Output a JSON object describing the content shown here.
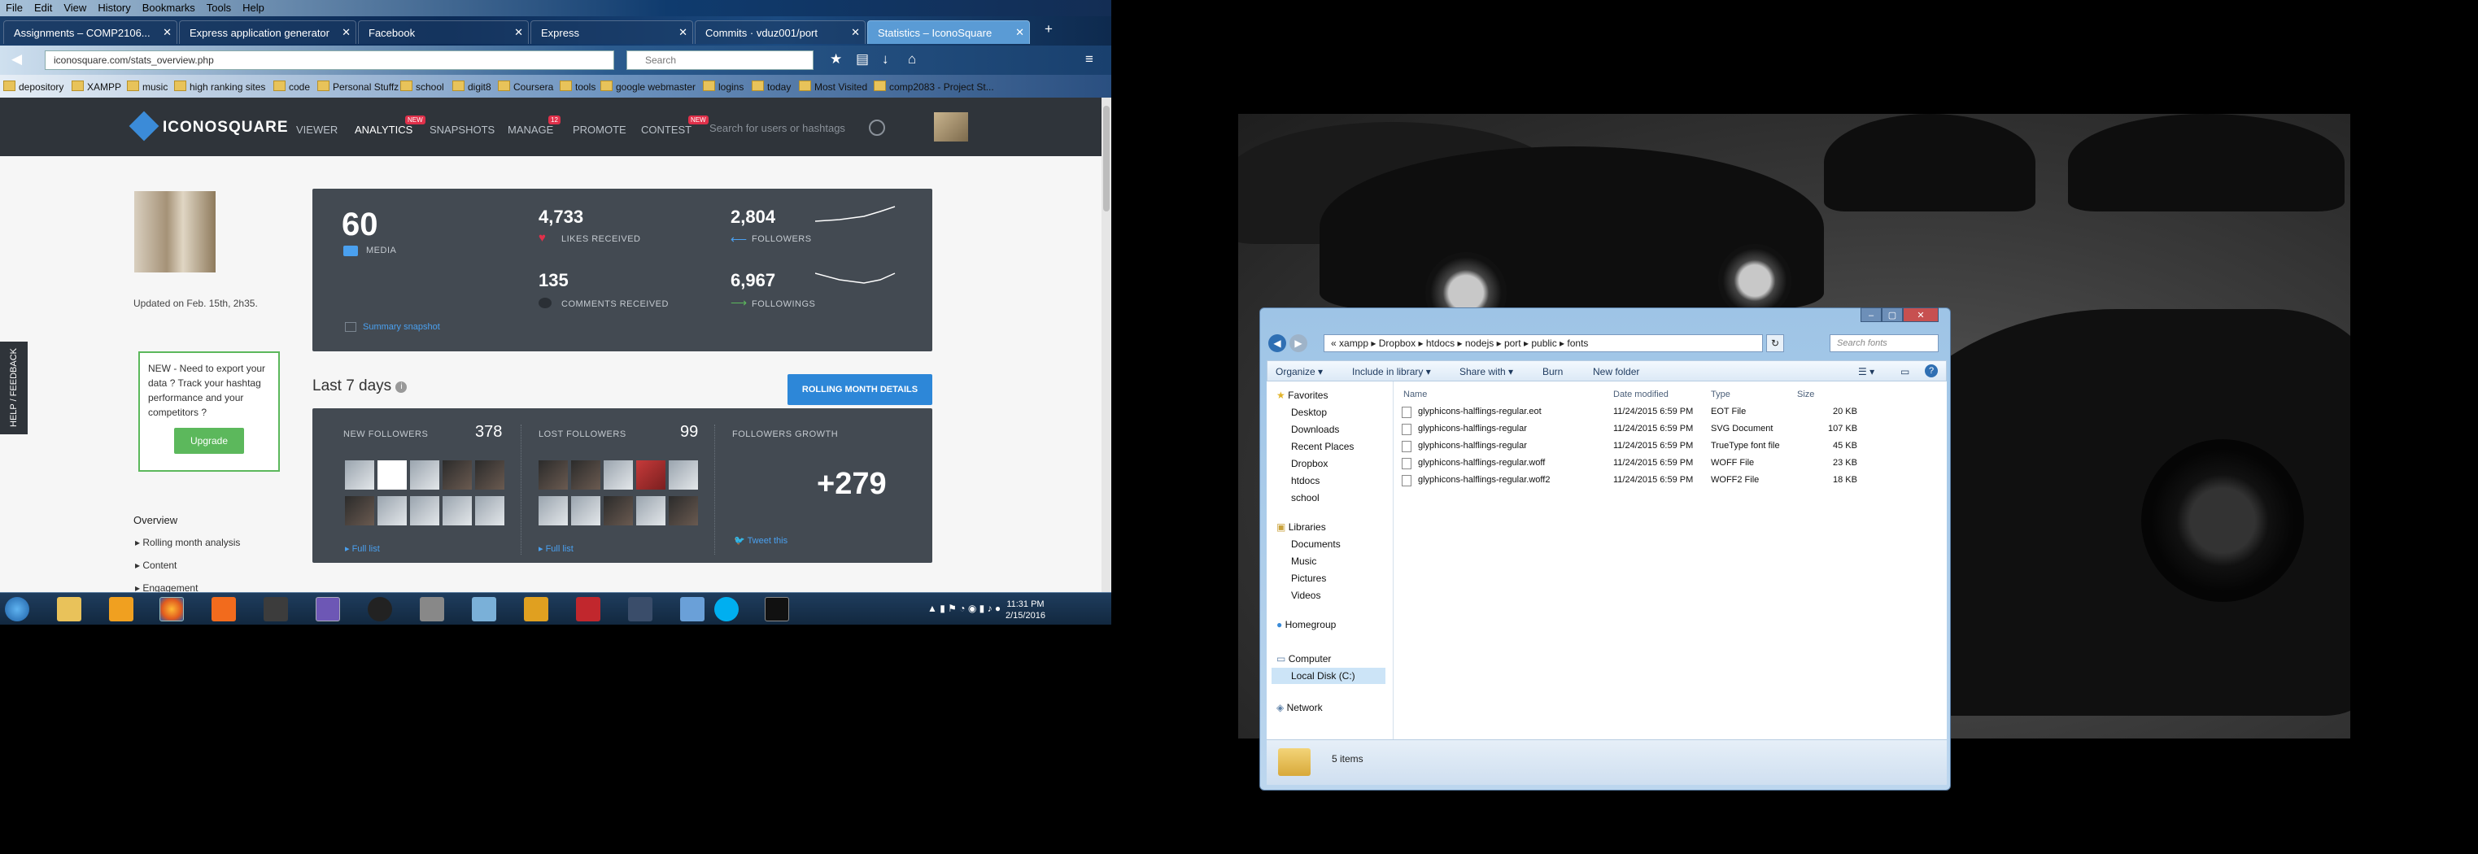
{
  "browser": {
    "menu": [
      "File",
      "Edit",
      "View",
      "History",
      "Bookmarks",
      "Tools",
      "Help"
    ],
    "tabs": [
      {
        "label": "Assignments – COMP2106..."
      },
      {
        "label": "Express application generator"
      },
      {
        "label": "Facebook"
      },
      {
        "label": "Express"
      },
      {
        "label": "Commits · vduz001/port"
      },
      {
        "label": "Statistics – IconoSquare"
      }
    ],
    "url": "iconosquare.com/stats_overview.php",
    "search_placeholder": "Search",
    "bookmarks": [
      "depository",
      "XAMPP",
      "music",
      "high ranking sites",
      "code",
      "Personal Stuffz",
      "school",
      "digit8",
      "Coursera",
      "tools",
      "google webmaster",
      "logins",
      "today",
      "Most Visited",
      "comp2083 - Project St..."
    ]
  },
  "site": {
    "logo": "ICONOSQUARE",
    "nav": [
      {
        "label": "VIEWER"
      },
      {
        "label": "ANALYTICS",
        "badge": "NEW"
      },
      {
        "label": "SNAPSHOTS"
      },
      {
        "label": "MANAGE",
        "badge": "12"
      },
      {
        "label": "PROMOTE"
      },
      {
        "label": "CONTEST",
        "badge": "NEW"
      }
    ],
    "search_placeholder": "Search for users or hashtags",
    "updated": "Updated on Feb. 15th, 2h35.",
    "export": {
      "text": "NEW - Need to export your data ? Track your hashtag performance and your competitors ?",
      "button": "Upgrade"
    },
    "feedback": "HELP / FEEDBACK",
    "overview": {
      "title": "Overview",
      "items": [
        "Rolling month analysis",
        "Content",
        "Engagement"
      ]
    },
    "stats": {
      "media": {
        "value": "60",
        "label": "MEDIA"
      },
      "likes": {
        "value": "4,733",
        "label": "LIKES RECEIVED"
      },
      "comments": {
        "value": "135",
        "label": "COMMENTS RECEIVED"
      },
      "followers": {
        "value": "2,804",
        "label": "FOLLOWERS"
      },
      "followings": {
        "value": "6,967",
        "label": "FOLLOWINGS"
      },
      "snapshot": "Summary snapshot"
    },
    "last7": "Last 7 days",
    "rolling_button": "ROLLING MONTH DETAILS",
    "new_followers": {
      "label": "NEW FOLLOWERS",
      "value": "378",
      "link": "Full list"
    },
    "lost_followers": {
      "label": "LOST FOLLOWERS",
      "value": "99",
      "link": "Full list"
    },
    "growth": {
      "label": "FOLLOWERS GROWTH",
      "value": "+279",
      "link": "Tweet this"
    }
  },
  "taskbar": {
    "time": "11:31 PM",
    "date": "2/15/2016"
  },
  "explorer": {
    "path": [
      "xampp",
      "Dropbox",
      "htdocs",
      "nodejs",
      "port",
      "public",
      "fonts"
    ],
    "search_placeholder": "Search fonts",
    "toolbar": [
      "Organize",
      "Include in library",
      "Share with",
      "Burn",
      "New folder"
    ],
    "nav": {
      "favorites": "Favorites",
      "favorites_items": [
        "Desktop",
        "Downloads",
        "Recent Places",
        "Dropbox",
        "htdocs",
        "school"
      ],
      "libraries": "Libraries",
      "libraries_items": [
        "Documents",
        "Music",
        "Pictures",
        "Videos"
      ],
      "homegroup": "Homegroup",
      "computer": "Computer",
      "local_disk": "Local Disk (C:)",
      "network": "Network"
    },
    "columns": [
      "Name",
      "Date modified",
      "Type",
      "Size"
    ],
    "files": [
      {
        "name": "glyphicons-halflings-regular.eot",
        "date": "11/24/2015 6:59 PM",
        "type": "EOT File",
        "size": "20 KB"
      },
      {
        "name": "glyphicons-halflings-regular",
        "date": "11/24/2015 6:59 PM",
        "type": "SVG Document",
        "size": "107 KB"
      },
      {
        "name": "glyphicons-halflings-regular",
        "date": "11/24/2015 6:59 PM",
        "type": "TrueType font file",
        "size": "45 KB"
      },
      {
        "name": "glyphicons-halflings-regular.woff",
        "date": "11/24/2015 6:59 PM",
        "type": "WOFF File",
        "size": "23 KB"
      },
      {
        "name": "glyphicons-halflings-regular.woff2",
        "date": "11/24/2015 6:59 PM",
        "type": "WOFF2 File",
        "size": "18 KB"
      }
    ],
    "status": "5 items"
  }
}
